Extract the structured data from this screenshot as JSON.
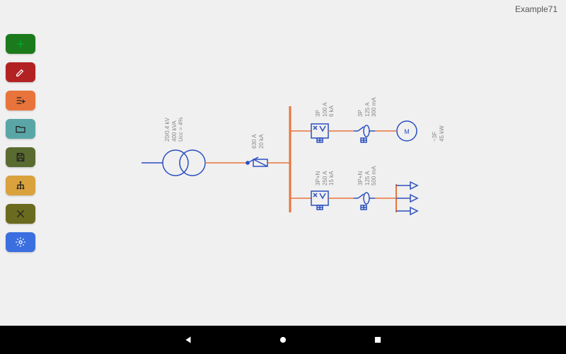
{
  "title": "Example71",
  "toolbar": [
    {
      "name": "add-button",
      "bg": "#1b7a1b",
      "icon": "plus"
    },
    {
      "name": "edit-button",
      "bg": "#b32222",
      "icon": "edit"
    },
    {
      "name": "add-list-button",
      "bg": "#e8743b",
      "icon": "list-plus"
    },
    {
      "name": "open-folder-button",
      "bg": "#5aa6a6",
      "icon": "folder"
    },
    {
      "name": "save-button",
      "bg": "#5a6b2f",
      "icon": "save"
    },
    {
      "name": "tree-button",
      "bg": "#d9a23d",
      "icon": "tree"
    },
    {
      "name": "tools-button",
      "bg": "#6b6b1f",
      "icon": "tools"
    },
    {
      "name": "settings-button",
      "bg": "#3b6fe0",
      "icon": "gear"
    }
  ],
  "colors": {
    "bus": "#e8743b",
    "wire": "#e8743b",
    "symbol": "#2a4fbf",
    "text": "#888"
  },
  "transformer": {
    "lines": [
      "20/0.4 kV",
      "400 kVA",
      "Ucc = 4%"
    ]
  },
  "fuse": {
    "lines": [
      "630 A",
      "20 kA"
    ]
  },
  "breakers": {
    "b1": {
      "lines": [
        "3P",
        "100 A",
        "6 kA"
      ]
    },
    "b2": {
      "lines": [
        "3P+N",
        "250 A",
        "15 kA"
      ]
    },
    "r1": {
      "lines": [
        "3P",
        "125 A",
        "300 mA"
      ]
    },
    "r2": {
      "lines": [
        "3P+N",
        "125 A",
        "500 mA"
      ]
    }
  },
  "motor": {
    "symbol": "M",
    "lines": [
      "~3F",
      "45 kW"
    ]
  }
}
